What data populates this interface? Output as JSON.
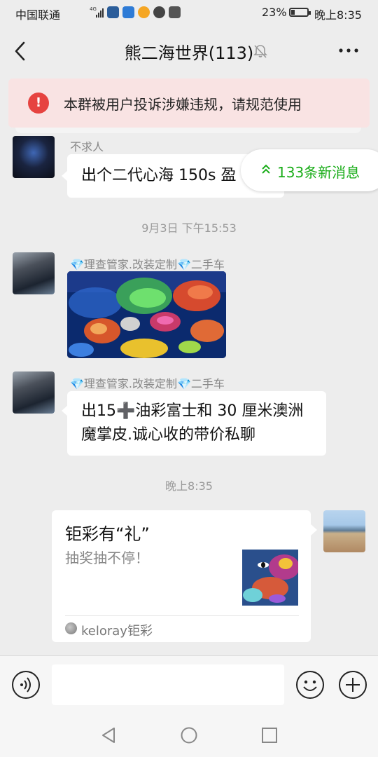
{
  "status_bar": {
    "carrier": "中国联通",
    "network": "4G",
    "battery_percent": "23%",
    "time": "晚上8:35",
    "icons": [
      "signal-icon",
      "app-notification-icon",
      "weibo-icon",
      "qq-icon",
      "browser-icon",
      "mail-icon"
    ]
  },
  "header": {
    "title": "熊二海世界(113)",
    "icons": [
      "back-icon",
      "mute-icon",
      "more-icon"
    ]
  },
  "warning": {
    "icon": "!",
    "text": "本群被用户投诉涉嫌违规，请规范使用"
  },
  "new_messages": {
    "icon": "≈",
    "label": "133条新消息"
  },
  "messages": [
    {
      "sender": "不求人",
      "text": "出个二代心海 150s 盈"
    },
    {
      "timestamp": "9月3日 下午15:53"
    },
    {
      "sender": "💎理查管家.改装定制💎二手车",
      "type": "image",
      "image_desc": "coral aquarium photo"
    },
    {
      "sender": "💎理查管家.改装定制💎二手车",
      "text": "出15➕油彩富士和 30 厘米澳洲魔掌皮.诚心收的带价私聊"
    },
    {
      "timestamp": "晚上8:35"
    },
    {
      "type": "card",
      "title": "钜彩有“礼”",
      "description": "抽奖抽不停！",
      "source": "keloray钜彩"
    }
  ],
  "input": {
    "value": "",
    "placeholder": ""
  },
  "colors": {
    "background": "#ededed",
    "accent_green": "#1aad19",
    "warning_red": "#e64340",
    "warning_bg": "#f9e3e3"
  }
}
